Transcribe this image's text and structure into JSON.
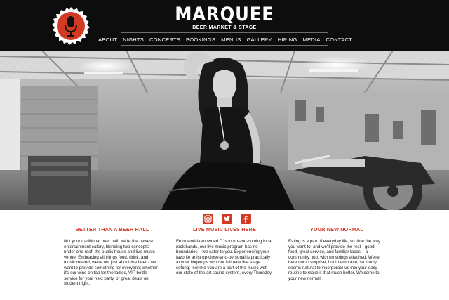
{
  "brand": {
    "title": "MARQUEE",
    "subtitle": "BEER MARKET & STAGE"
  },
  "nav": {
    "items": [
      "ABOUT",
      "NIGHTS",
      "CONCERTS",
      "BOOKINGS",
      "MENUS",
      "GALLERY",
      "HIRING",
      "MEDIA",
      "CONTACT"
    ]
  },
  "social": {
    "icons": [
      "instagram-icon",
      "twitter-icon",
      "facebook-icon"
    ]
  },
  "columns": [
    {
      "title": "BETTER THAN A BEER HALL",
      "body": "Not your traditional beer hall, we're the newest entertainment eatery, blending two concepts under one roof: the public house and live music venue. Embracing all things food, drink, and music related, we're not just about the beer - we want to provide something for everyone; whether it's our wine on tap for the ladies, VIP bottle service for your next party, or great deals on student night."
    },
    {
      "title": "LIVE MUSIC LIVES HERE",
      "body": "From world-renowned DJs to up-and-coming local rock bands, our live music program has no boundaries – we cater to you. Experiencing your favorite artist up-close-and-personal is practically at your fingertips with our intimate live stage setting; feel like you are a part of the music with our state of the art sound system, every Thursday."
    },
    {
      "title": "YOUR NEW NORMAL",
      "body": "Eating is a part of everyday life, so dine the way you want to, and we'll provide the rest - good food, great service, and familiar faces – a community hub, with no strings attached. We're here not to surprise, but to embrace, so it only seems natural to incorporate us into your daily routine to make it that much better. Welcome to your new normal."
    }
  ],
  "colors": {
    "accent": "#d33a24",
    "header_bg": "#0d0d0d"
  }
}
